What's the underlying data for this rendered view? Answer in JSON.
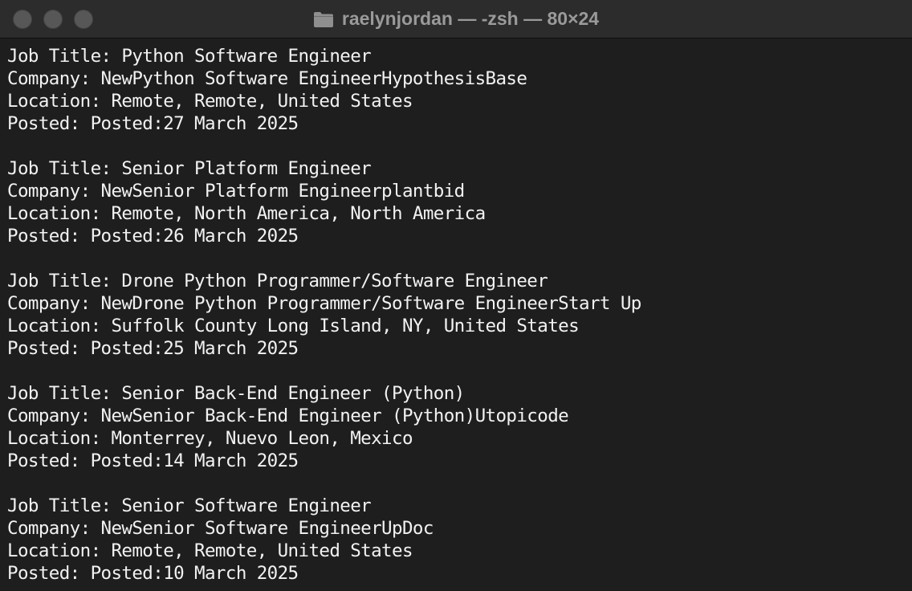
{
  "window": {
    "title": "raelynjordan — -zsh — 80×24"
  },
  "jobs": [
    {
      "title_line": "Job Title: Python Software Engineer",
      "company_line": "Company: NewPython Software EngineerHypothesisBase",
      "location_line": "Location: Remote, Remote, United States",
      "posted_line": "Posted: Posted:27 March 2025"
    },
    {
      "title_line": "Job Title: Senior Platform Engineer",
      "company_line": "Company: NewSenior Platform Engineerplantbid",
      "location_line": "Location: Remote, North America, North America",
      "posted_line": "Posted: Posted:26 March 2025"
    },
    {
      "title_line": "Job Title: Drone Python Programmer/Software Engineer",
      "company_line": "Company: NewDrone Python Programmer/Software EngineerStart Up",
      "location_line": "Location: Suffolk County Long Island, NY, United States",
      "posted_line": "Posted: Posted:25 March 2025"
    },
    {
      "title_line": "Job Title: Senior Back-End Engineer (Python)",
      "company_line": "Company: NewSenior Back-End Engineer (Python)Utopicode",
      "location_line": "Location: Monterrey, Nuevo Leon, Mexico",
      "posted_line": "Posted: Posted:14 March 2025"
    },
    {
      "title_line": "Job Title: Senior Software Engineer",
      "company_line": "Company: NewSenior Software EngineerUpDoc",
      "location_line": "Location: Remote, Remote, United States",
      "posted_line": "Posted: Posted:10 March 2025"
    }
  ]
}
